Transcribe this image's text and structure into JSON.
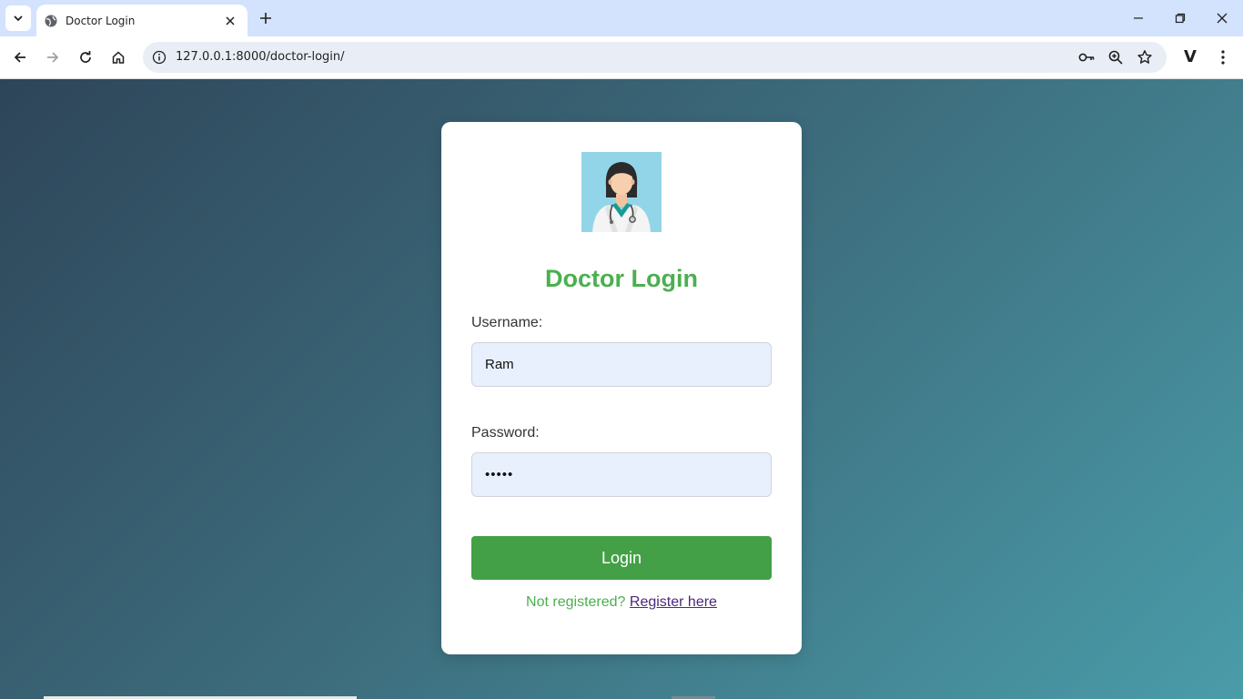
{
  "browser": {
    "tab_title": "Doctor Login",
    "url": "127.0.0.1:8000/doctor-login/"
  },
  "login": {
    "title": "Doctor Login",
    "username_label": "Username:",
    "username_value": "Ram",
    "password_label": "Password:",
    "password_value": "•••••",
    "login_button": "Login",
    "not_registered_text": "Not registered?",
    "register_link": "Register here"
  },
  "colors": {
    "accent_green": "#4caf50",
    "button_green": "#43a047",
    "link_purple": "#4a2a7a",
    "tabbar": "#d3e3fd"
  },
  "icons": [
    "tab-search-icon",
    "globe-icon",
    "close-icon",
    "plus-icon",
    "minimize-icon",
    "restore-icon",
    "window-close-icon",
    "back-icon",
    "forward-icon",
    "reload-icon",
    "home-icon",
    "site-info-icon",
    "password-key-icon",
    "zoom-icon",
    "bookmark-star-icon",
    "menu-dots-icon",
    "doctor-avatar"
  ]
}
